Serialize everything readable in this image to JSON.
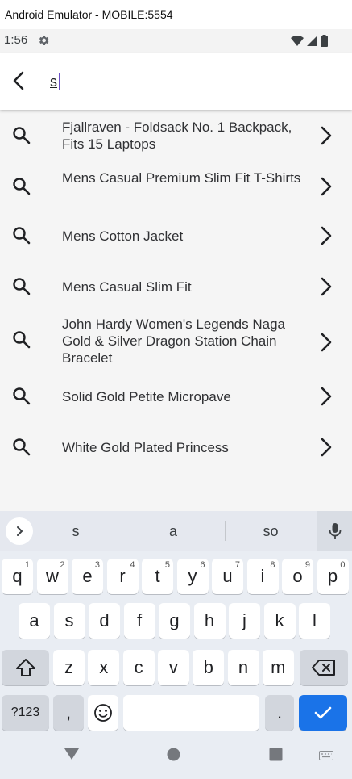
{
  "window": {
    "title": "Android Emulator - MOBILE:5554"
  },
  "status_bar": {
    "time": "1:56",
    "icons": [
      "gear-icon",
      "wifi-icon",
      "signal-icon",
      "battery-icon"
    ]
  },
  "search": {
    "query": "s",
    "back_icon": "back-arrow-icon"
  },
  "results": [
    {
      "label": "Fjallraven - Foldsack No. 1 Backpack, Fits 15 Laptops"
    },
    {
      "label": "Mens Casual Premium Slim Fit T-Shirts"
    },
    {
      "label": "Mens Cotton Jacket"
    },
    {
      "label": "Mens Casual Slim Fit"
    },
    {
      "label": "John Hardy Women's Legends Naga Gold & Silver Dragon Station Chain Bracelet"
    },
    {
      "label": "Solid Gold Petite Micropave"
    },
    {
      "label": "White Gold Plated Princess"
    }
  ],
  "keyboard": {
    "suggestions": [
      "s",
      "a",
      "so"
    ],
    "row1": [
      {
        "k": "q",
        "n": "1"
      },
      {
        "k": "w",
        "n": "2"
      },
      {
        "k": "e",
        "n": "3"
      },
      {
        "k": "r",
        "n": "4"
      },
      {
        "k": "t",
        "n": "5"
      },
      {
        "k": "y",
        "n": "6"
      },
      {
        "k": "u",
        "n": "7"
      },
      {
        "k": "i",
        "n": "8"
      },
      {
        "k": "o",
        "n": "9"
      },
      {
        "k": "p",
        "n": "0"
      }
    ],
    "row2": [
      "a",
      "s",
      "d",
      "f",
      "g",
      "h",
      "j",
      "k",
      "l"
    ],
    "row3": [
      "z",
      "x",
      "c",
      "v",
      "b",
      "n",
      "m"
    ],
    "symbols_label": "?123",
    "comma_label": ",",
    "period_label": "."
  },
  "colors": {
    "accent": "#1a73e8",
    "caret": "#6a4fc6",
    "results_bg": "#f5f5f5",
    "keyboard_bg": "#e9edf3"
  }
}
